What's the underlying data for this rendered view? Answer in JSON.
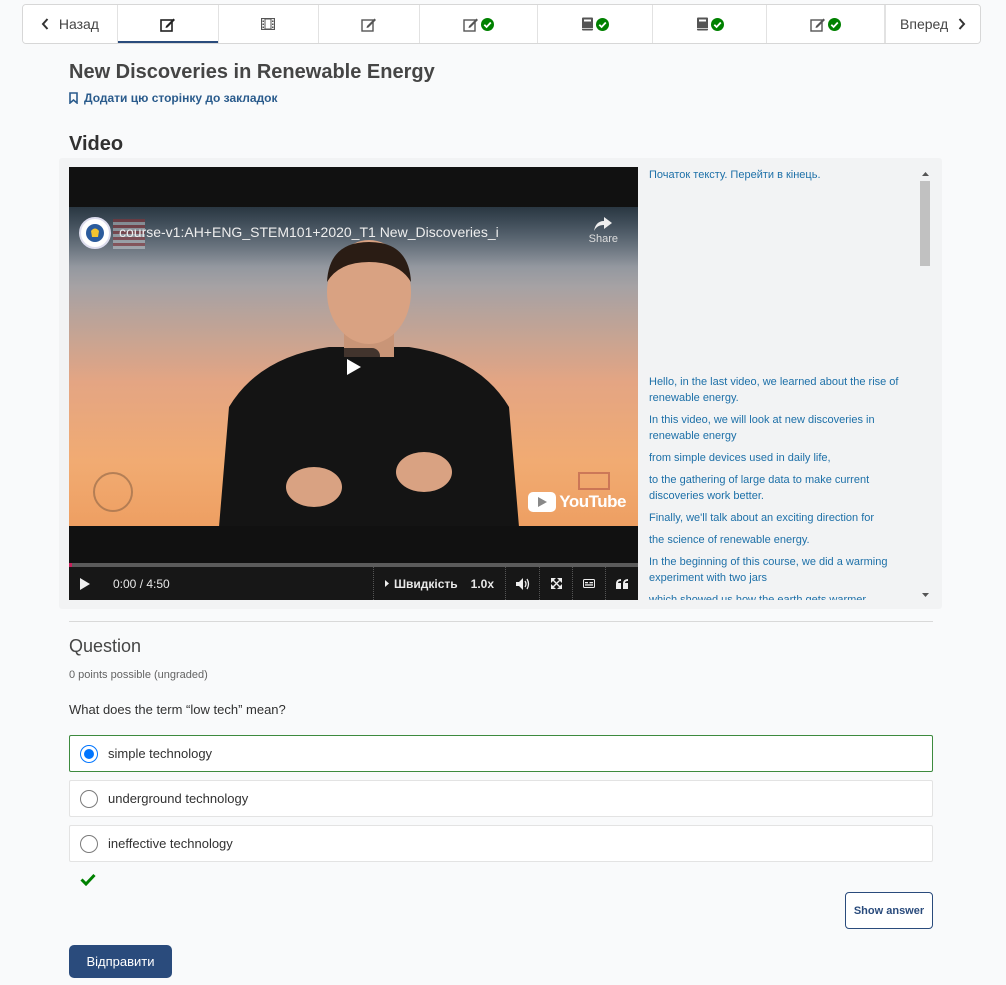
{
  "nav": {
    "prev_label": "Назад",
    "next_label": "Вперед",
    "units": [
      {
        "icon": "edit-icon",
        "complete": false,
        "active": true
      },
      {
        "icon": "film-icon",
        "complete": false,
        "active": false
      },
      {
        "icon": "edit-icon",
        "complete": false,
        "active": false
      },
      {
        "icon": "edit-icon",
        "complete": true,
        "active": false
      },
      {
        "icon": "book-icon",
        "complete": true,
        "active": false
      },
      {
        "icon": "book-icon",
        "complete": true,
        "active": false
      },
      {
        "icon": "edit-icon",
        "complete": true,
        "active": false
      }
    ],
    "complete_color": "#008100"
  },
  "page": {
    "title": "New Discoveries in Renewable Energy",
    "bookmark_label": "Додати цю сторінку до закладок"
  },
  "video": {
    "section_title": "Video",
    "yt_title": "course-v1:AH+ENG_STEM101+2020_T1 New_Discoveries_i",
    "share_label": "Share",
    "youtube_label": "YouTube",
    "time": "0:00 / 4:50",
    "speed_label": "Швидкість",
    "speed_value": "1.0x",
    "transcript_skip": "Початок тексту. Перейти в кінець.",
    "transcript": [
      "Hello, in the last video, we learned about the rise of renewable energy.",
      "In this video, we will look at new discoveries in renewable energy",
      "from simple devices used in daily life,",
      "to the gathering of large data to make current discoveries work better.",
      "Finally, we'll talk about an exciting direction for",
      "the science of renewable energy.",
      "In the beginning of this course, we did a warming experiment with two jars",
      "which showed us how the earth gets warmer"
    ]
  },
  "question": {
    "title": "Question",
    "points": "0 points possible (ungraded)",
    "prompt": "What does the term “low tech” mean?",
    "choices": [
      {
        "label": "simple technology",
        "selected": true
      },
      {
        "label": "underground technology",
        "selected": false
      },
      {
        "label": "ineffective technology",
        "selected": false
      }
    ],
    "show_answer_label": "Show answer",
    "submit_label": "Відправити",
    "accent_color": "#2a4b7c"
  }
}
